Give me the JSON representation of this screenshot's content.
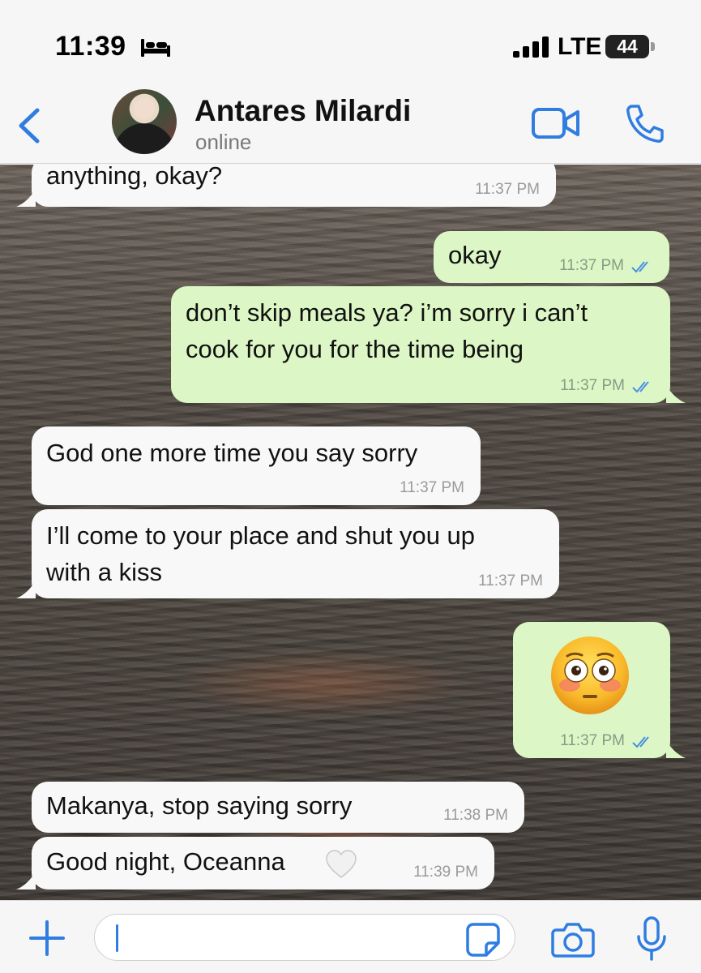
{
  "status_bar": {
    "time": "11:39",
    "network": "LTE",
    "battery_level": "44",
    "icons": [
      "bed-icon",
      "signal-icon",
      "battery-icon"
    ]
  },
  "header": {
    "contact_name": "Antares Milardi",
    "contact_status": "online",
    "icons": [
      "back-icon",
      "avatar",
      "video-call-icon",
      "voice-call-icon"
    ],
    "accent_color": "#2f7de1"
  },
  "messages": [
    {
      "direction": "incoming",
      "text": "anything, okay?",
      "time": "11:37 PM"
    },
    {
      "direction": "outgoing",
      "text": "okay",
      "time": "11:37 PM",
      "status": "read"
    },
    {
      "direction": "outgoing",
      "text": "don’t skip meals ya? i’m sorry i can’t\ncook for you for the time being",
      "time": "11:37 PM",
      "status": "read"
    },
    {
      "direction": "incoming",
      "text": "God one more time you say sorry",
      "time": "11:37 PM"
    },
    {
      "direction": "incoming",
      "text": "I’ll come to your place and shut you up\nwith a kiss",
      "time": "11:37 PM"
    },
    {
      "direction": "outgoing",
      "text": "",
      "emoji": "flushed-face",
      "time": "11:37 PM",
      "status": "read"
    },
    {
      "direction": "incoming",
      "text": "Makanya, stop saying sorry",
      "time": "11:38 PM"
    },
    {
      "direction": "incoming",
      "text": "Good night, Oceanna",
      "emoji": "white-heart",
      "time": "11:39 PM"
    }
  ],
  "colors": {
    "incoming_bubble": "#f8f8f8",
    "outgoing_bubble": "#dcf7c5",
    "read_ticks": "#4a90e2"
  },
  "input_bar": {
    "message_value": "",
    "icons": [
      "plus-icon",
      "sticker-icon",
      "camera-icon",
      "microphone-icon"
    ]
  }
}
